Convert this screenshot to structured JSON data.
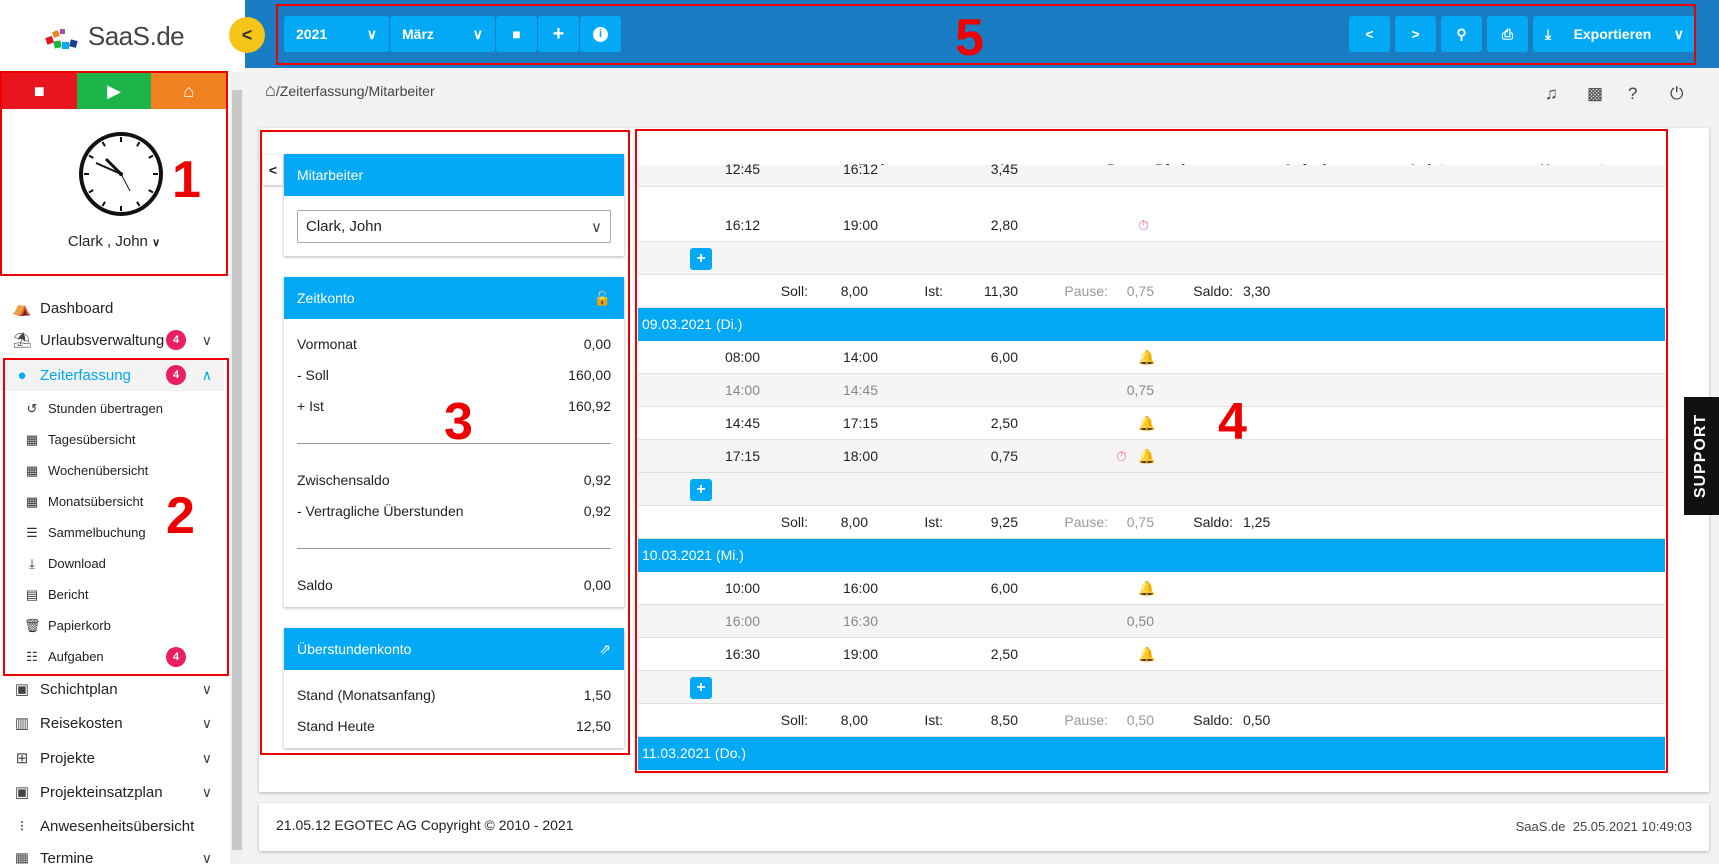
{
  "logo": {
    "text": "SaaS.de"
  },
  "timer": {
    "stop_icon": "stop-icon",
    "start_icon": "play-icon",
    "home_icon": "home-office-icon",
    "colors": {
      "stop": "#e8141e",
      "start": "#1db54a",
      "home": "#f18021"
    }
  },
  "user": {
    "name": "Clark , John"
  },
  "nav": [
    {
      "label": "Dashboard",
      "icon": "dashboard-icon"
    },
    {
      "label": "Urlaubsverwaltung",
      "icon": "beach-umbrella-icon",
      "badge": "4"
    },
    {
      "label": "Zeiterfassung",
      "icon": "clock-icon",
      "badge": "4"
    },
    {
      "label": "Schichtplan",
      "icon": "clipboard-icon"
    },
    {
      "label": "Reisekosten",
      "icon": "luggage-icon"
    },
    {
      "label": "Projekte",
      "icon": "sitemap-icon"
    },
    {
      "label": "Projekteinsatzplan",
      "icon": "clipboard-check-icon"
    },
    {
      "label": "Anwesenheitsübersicht",
      "icon": "traffic-light-icon"
    },
    {
      "label": "Termine",
      "icon": "calendar-icon"
    }
  ],
  "subnav": [
    {
      "label": "Stunden übertragen",
      "icon": "history-icon"
    },
    {
      "label": "Tagesübersicht",
      "icon": "calendar-day-icon"
    },
    {
      "label": "Wochenübersicht",
      "icon": "calendar-week-icon"
    },
    {
      "label": "Monatsübersicht",
      "icon": "calendar-month-icon"
    },
    {
      "label": "Sammelbuchung",
      "icon": "list-stack-icon"
    },
    {
      "label": "Download",
      "icon": "download-icon"
    },
    {
      "label": "Bericht",
      "icon": "excel-file-icon"
    },
    {
      "label": "Papierkorb",
      "icon": "trash-icon"
    },
    {
      "label": "Aufgaben",
      "icon": "task-list-icon",
      "badge": "4"
    }
  ],
  "toolbar": {
    "year": "2021",
    "month": "März",
    "export": "Exportieren"
  },
  "breadcrumb": "/Zeiterfassung/Mitarbeiter",
  "panel": {
    "mitarbeiter": {
      "title": "Mitarbeiter",
      "value": "Clark, John"
    },
    "zeitkonto": {
      "title": "Zeitkonto",
      "rows": [
        {
          "label": "Vormonat",
          "value": "0,00"
        },
        {
          "label": "- Soll",
          "value": "160,00"
        },
        {
          "label": "+ Ist",
          "value": "160,92"
        },
        {
          "label": "Zwischensaldo",
          "value": "0,92"
        },
        {
          "label": "- Vertragliche Überstunden",
          "value": "0,92"
        },
        {
          "label": "Saldo",
          "value": "0,00"
        }
      ]
    },
    "ueberstunden": {
      "title": "Überstundenkonto",
      "rows": [
        {
          "label": "Stand (Monatsanfang)",
          "value": "1,50"
        },
        {
          "label": "Stand Heute",
          "value": "12,50"
        }
      ]
    }
  },
  "table": {
    "headers": {
      "start": "Start",
      "ende": "Ende",
      "ist": "Ist",
      "pause": "Pause",
      "pfad": "Pfad",
      "aufgabe": "Aufgabe",
      "leistung": "Leistung",
      "kommentar": "Kommentar"
    },
    "summary_labels": {
      "soll": "Soll:",
      "ist": "Ist:",
      "pause": "Pause:",
      "saldo": "Saldo:"
    },
    "top_partial": {
      "start": "12:45",
      "ende": "16:12",
      "ist": "3,45"
    },
    "rows_a": [
      {
        "start": "16:12",
        "ende": "19:00",
        "ist": "2,80"
      }
    ],
    "summary_a": {
      "soll": "8,00",
      "ist": "11,30",
      "pause": "0,75",
      "saldo": "3,30"
    },
    "day_b": "09.03.2021 (Di.)",
    "rows_b": [
      {
        "start": "08:00",
        "ende": "14:00",
        "ist": "6,00"
      },
      {
        "start": "14:00",
        "ende": "14:45",
        "pause": "0,75"
      },
      {
        "start": "14:45",
        "ende": "17:15",
        "ist": "2,50"
      },
      {
        "start": "17:15",
        "ende": "18:00",
        "ist": "0,75"
      }
    ],
    "summary_b": {
      "soll": "8,00",
      "ist": "9,25",
      "pause": "0,75",
      "saldo": "1,25"
    },
    "day_c": "10.03.2021 (Mi.)",
    "rows_c": [
      {
        "start": "10:00",
        "ende": "16:00",
        "ist": "6,00"
      },
      {
        "start": "16:00",
        "ende": "16:30",
        "pause": "0,50"
      },
      {
        "start": "16:30",
        "ende": "19:00",
        "ist": "2,50"
      }
    ],
    "summary_c": {
      "soll": "8,00",
      "ist": "8,50",
      "pause": "0,50",
      "saldo": "0,50"
    },
    "day_d": "11.03.2021 (Do.)"
  },
  "footer": {
    "left": "21.05.12 EGOTEC AG Copyright © 2010 - 2021",
    "right_brand": "SaaS.de",
    "right_time": "25.05.2021 10:49:03"
  },
  "support": "SUPPORT",
  "annotations": [
    "1",
    "2",
    "3",
    "4",
    "5"
  ]
}
